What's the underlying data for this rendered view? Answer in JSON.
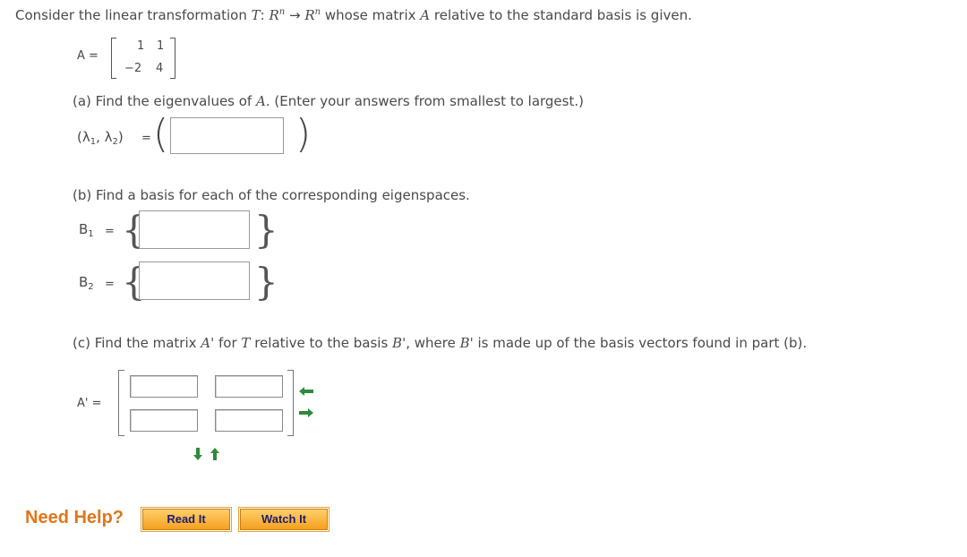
{
  "intro": {
    "text_a": "Consider the linear transformation ",
    "T": "T",
    "colon": ": ",
    "Rn1": "R",
    "n1": "n",
    "maps": " → ",
    "Rn2": "R",
    "n2": "n",
    "text_b": "  whose matrix ",
    "A": "A",
    "text_c": " relative to the standard basis is given."
  },
  "matrixA": {
    "label": "A =",
    "r1c1": "1",
    "r1c2": "1",
    "r2c1": "−2",
    "r2c2": "4"
  },
  "partA": {
    "prompt_a": "(a) Find the eigenvalues of ",
    "A": "A",
    "prompt_b": ". (Enter your answers from smallest to largest.)",
    "lambda_label_open": "(λ",
    "sub1": "1",
    "comma": ", λ",
    "sub2": "2",
    "lambda_label_close": ")",
    "eq": "=",
    "answer": ""
  },
  "partB": {
    "prompt": "(b) Find a basis for each of the corresponding eigenspaces.",
    "B1_label": "B",
    "B1_sub": "1",
    "B2_label": "B",
    "B2_sub": "2",
    "eq": "=",
    "B1_answer": "",
    "B2_answer": ""
  },
  "partC": {
    "prompt_a": "(c) Find the matrix ",
    "Aprime": "A'",
    "prompt_b": " for ",
    "T": "T",
    "prompt_c": " relative to the basis ",
    "Bprime1": "B'",
    "prompt_d": ", where ",
    "Bprime2": "B'",
    "prompt_e": " is made up of the basis vectors found in part (b).",
    "label": "A' =",
    "cells": [
      "",
      "",
      "",
      ""
    ]
  },
  "help": {
    "label": "Need Help?",
    "read_it": "Read It",
    "watch_it": "Watch It"
  },
  "colors": {
    "arrow": "#2e8b3a",
    "help": "#e0761b",
    "button": "#f5a020"
  }
}
